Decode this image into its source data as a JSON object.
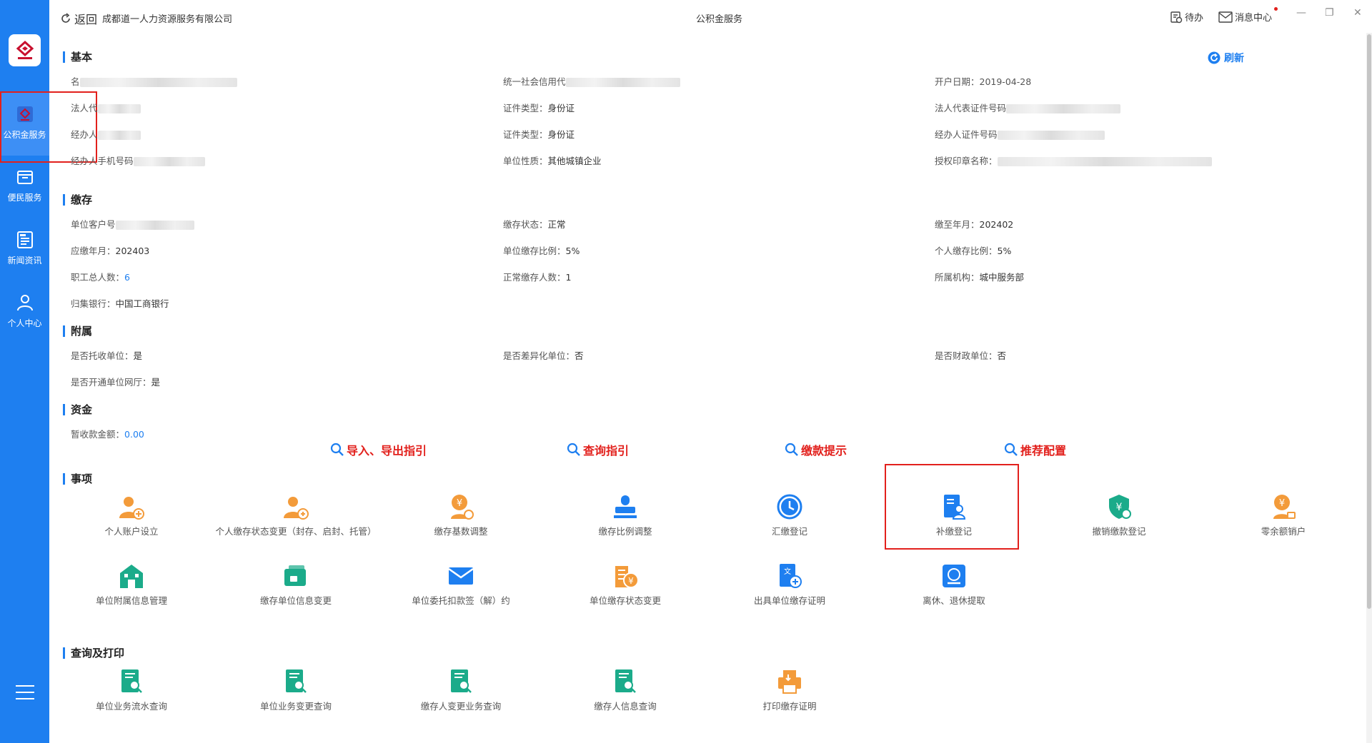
{
  "sidebar": {
    "logo_text": "公积金",
    "items": [
      {
        "label": "公积金服务",
        "icon": "housing-fund-icon"
      },
      {
        "label": "便民服务",
        "icon": "wallet-icon"
      },
      {
        "label": "新闻资讯",
        "icon": "news-icon"
      },
      {
        "label": "个人中心",
        "icon": "user-icon"
      }
    ],
    "menu_icon": "hamburger-icon"
  },
  "topbar": {
    "back_label": "返回",
    "company": "成都道一人力资源服务有限公司",
    "title": "公积金服务",
    "todo_label": "待办",
    "message_label": "消息中心"
  },
  "refresh_label": "刷新",
  "basic": {
    "title": "基本",
    "name_label": "名",
    "credit_code_label": "统一社会信用代",
    "open_date": "开户日期：2019-04-28",
    "legal_rep_label": "法人代",
    "id_type_1": "证件类型：",
    "id_type_1_value": "身份证",
    "legal_id_label": "法人代表证件号码",
    "handler_label": "经办人",
    "id_type_2": "证件类型：",
    "id_type_2_value": "身份证",
    "handler_id_label": "经办人证件号码",
    "handler_phone_label": "经办人手机号码",
    "unit_nature": "单位性质：",
    "unit_nature_value": "其他城镇企业",
    "seal_label": "授权印章名称："
  },
  "deposit": {
    "title": "缴存",
    "customer_no_label": "单位客户号",
    "status_label": "缴存状态：",
    "status_value": "正常",
    "paid_to_label": "缴至年月：",
    "paid_to_value": "202402",
    "due_label": "应缴年月：",
    "due_value": "202403",
    "unit_ratio_label": "单位缴存比例：",
    "unit_ratio_value": "5%",
    "personal_ratio_label": "个人缴存比例：",
    "personal_ratio_value": "5%",
    "employees_label": "职工总人数：",
    "employees_value": "6",
    "normal_label": "正常缴存人数：",
    "normal_value": "1",
    "org_label": "所属机构：",
    "org_value": "城中服务部",
    "bank_label": "归集银行：",
    "bank_value": "中国工商银行"
  },
  "affiliate": {
    "title": "附属",
    "entrusted_label": "是否托收单位：",
    "entrusted_value": "是",
    "differentiated_label": "是否差异化单位：",
    "differentiated_value": "否",
    "finance_label": "是否财政单位：",
    "finance_value": "否",
    "online_label": "是否开通单位网厅：",
    "online_value": "是"
  },
  "funds": {
    "title": "资金",
    "temp_label": "暂收款金额：",
    "temp_value": "0.00"
  },
  "guides": [
    {
      "label": "导入、导出指引"
    },
    {
      "label": "查询指引"
    },
    {
      "label": "缴款提示"
    },
    {
      "label": "推荐配置"
    }
  ],
  "matters": {
    "title": "事项",
    "items": [
      {
        "label": "个人账户设立",
        "icon": "add-user-icon",
        "color": "#f39b3a"
      },
      {
        "label": "个人缴存状态变更（封存、启封、托管）",
        "icon": "user-status-icon",
        "color": "#f39b3a"
      },
      {
        "label": "缴存基数调整",
        "icon": "yuan-user-icon",
        "color": "#f39b3a"
      },
      {
        "label": "缴存比例调整",
        "icon": "stamp-icon",
        "color": "#1e7ff0"
      },
      {
        "label": "汇缴登记",
        "icon": "clock-icon",
        "color": "#1e7ff0"
      },
      {
        "label": "补缴登记",
        "icon": "document-user-icon",
        "color": "#1e7ff0"
      },
      {
        "label": "撤销缴款登记",
        "icon": "shield-yuan-icon",
        "color": "#1bab8a"
      },
      {
        "label": "零余额销户",
        "icon": "yuan-lock-icon",
        "color": "#f39b3a"
      },
      {
        "label": "单位附属信息管理",
        "icon": "building-icon",
        "color": "#1bab8a"
      },
      {
        "label": "缴存单位信息变更",
        "icon": "wallet-lock-icon",
        "color": "#1bab8a"
      },
      {
        "label": "单位委托扣款签（解）约",
        "icon": "envelope-icon",
        "color": "#1e7ff0"
      },
      {
        "label": "单位缴存状态变更",
        "icon": "building-yuan-icon",
        "color": "#f39b3a"
      },
      {
        "label": "出具单位缴存证明",
        "icon": "certificate-icon",
        "color": "#1e7ff0"
      },
      {
        "label": "离休、退休提取",
        "icon": "withdraw-icon",
        "color": "#1e7ff0"
      }
    ]
  },
  "queries": {
    "title": "查询及打印",
    "items": [
      {
        "label": "单位业务流水查询",
        "icon": "search-doc-icon",
        "color": "#1bab8a"
      },
      {
        "label": "单位业务变更查询",
        "icon": "search-doc-icon",
        "color": "#1bab8a"
      },
      {
        "label": "缴存人变更业务查询",
        "icon": "search-doc-icon",
        "color": "#1bab8a"
      },
      {
        "label": "缴存人信息查询",
        "icon": "search-doc-icon",
        "color": "#1bab8a"
      },
      {
        "label": "打印缴存证明",
        "icon": "printer-icon",
        "color": "#f39b3a"
      }
    ]
  }
}
